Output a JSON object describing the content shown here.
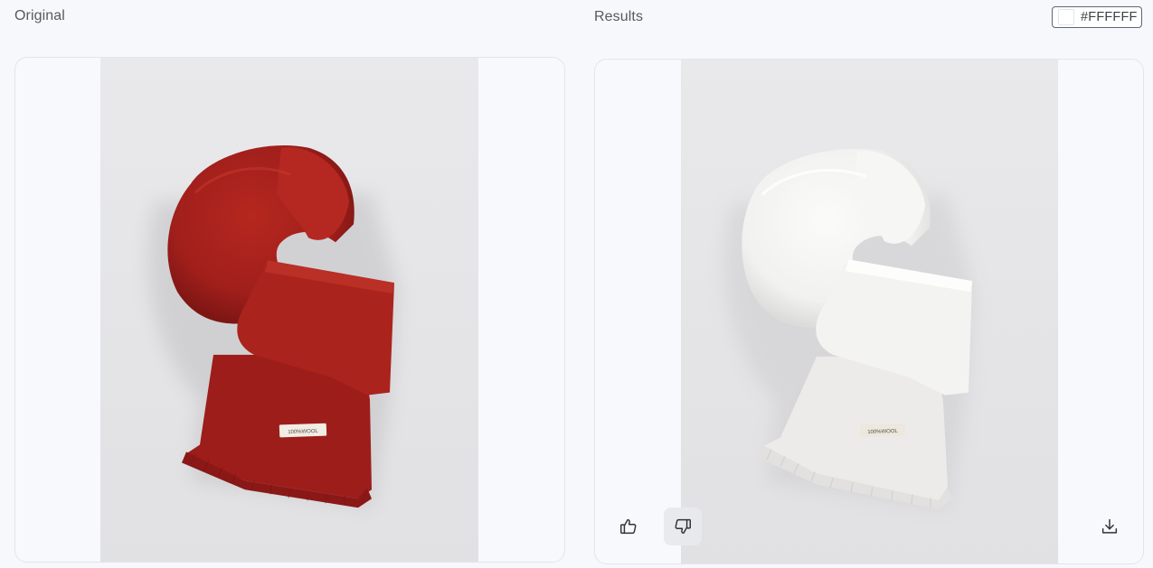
{
  "labels": {
    "original": "Original",
    "results": "Results"
  },
  "background_color": {
    "hex": "#FFFFFF"
  },
  "original_image": {
    "scarf_color": "#a7211d",
    "tag_text": "100%WOOL"
  },
  "result_image": {
    "scarf_color": "#f4f4f2",
    "tag_text": "100%WOOL"
  },
  "actions": {
    "like_icon": "thumbs-up-icon",
    "dislike_icon": "thumbs-down-icon",
    "download_icon": "download-icon"
  }
}
